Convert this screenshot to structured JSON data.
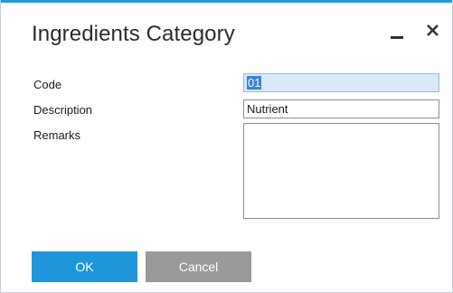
{
  "window": {
    "title": "Ingredients Category",
    "controls": {
      "minimize_icon": "minimize-icon",
      "close_icon": "close-icon"
    }
  },
  "form": {
    "code": {
      "label": "Code",
      "value": "01"
    },
    "description": {
      "label": "Description",
      "value": "Nutrient"
    },
    "remarks": {
      "label": "Remarks",
      "value": ""
    }
  },
  "buttons": {
    "ok_label": "OK",
    "cancel_label": "Cancel"
  },
  "colors": {
    "accent": "#1e9be0",
    "ok_button": "#1f96dc",
    "cancel_button": "#9a9a9a",
    "selection": "#3a83d6"
  }
}
